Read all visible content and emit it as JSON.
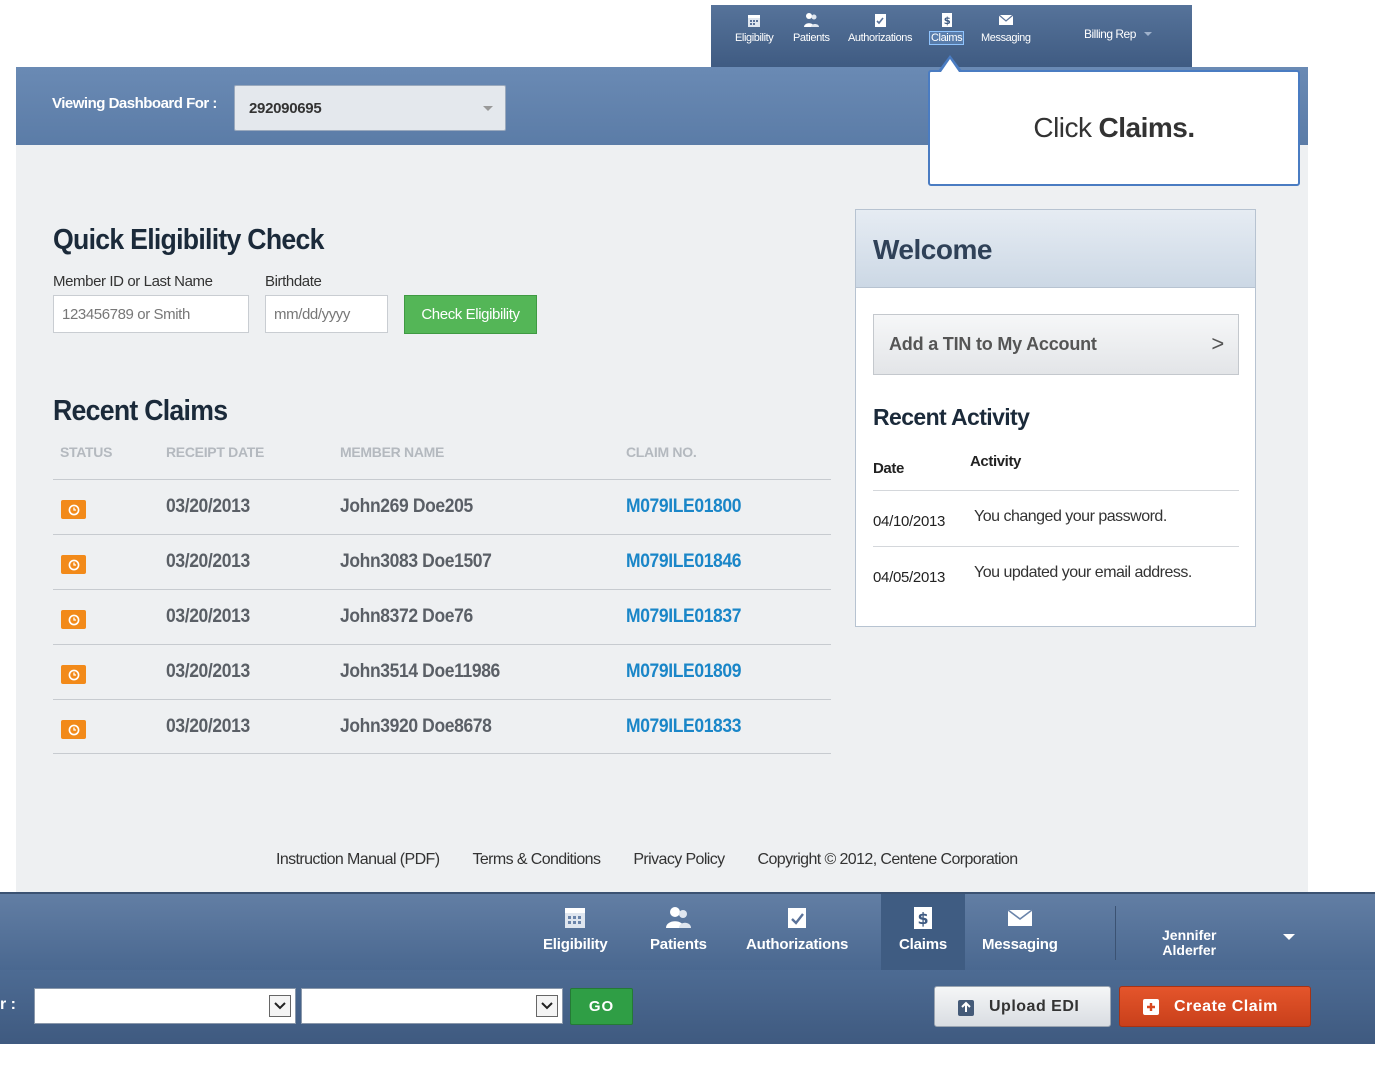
{
  "mini_nav": {
    "items": [
      {
        "label": "Eligibility",
        "icon": "calendar-icon"
      },
      {
        "label": "Patients",
        "icon": "people-icon"
      },
      {
        "label": "Authorizations",
        "icon": "checklist-icon"
      },
      {
        "label": "Claims",
        "icon": "dollar-doc-icon"
      },
      {
        "label": "Messaging",
        "icon": "envelope-icon"
      }
    ],
    "user": "Billing Rep"
  },
  "header": {
    "viewing_label": "Viewing Dashboard For :",
    "tin_value": "292090695"
  },
  "callout": {
    "prefix": "Click",
    "emphasis": "Claims."
  },
  "quick_eligibility": {
    "title": "Quick Eligibility Check",
    "member_label": "Member ID or Last Name",
    "member_placeholder": "123456789 or Smith",
    "birthdate_label": "Birthdate",
    "birthdate_placeholder": "mm/dd/yyyy",
    "button": "Check Eligibility"
  },
  "recent_claims": {
    "title": "Recent Claims",
    "columns": [
      "STATUS",
      "RECEIPT DATE",
      "MEMBER NAME",
      "CLAIM NO."
    ],
    "rows": [
      {
        "date": "03/20/2013",
        "member": "John269 Doe205",
        "claim": "M079ILE01800"
      },
      {
        "date": "03/20/2013",
        "member": "John3083 Doe1507",
        "claim": "M079ILE01846"
      },
      {
        "date": "03/20/2013",
        "member": "John8372 Doe76",
        "claim": "M079ILE01837"
      },
      {
        "date": "03/20/2013",
        "member": "John3514 Doe11986",
        "claim": "M079ILE01809"
      },
      {
        "date": "03/20/2013",
        "member": "John3920 Doe8678",
        "claim": "M079ILE01833"
      }
    ]
  },
  "welcome": {
    "title": "Welcome",
    "add_tin": "Add a TIN to My Account",
    "add_tin_chevron": ">",
    "recent_activity_title": "Recent Activity",
    "col_date": "Date",
    "col_activity": "Activity",
    "rows": [
      {
        "date": "04/10/2013",
        "text": "You changed your password."
      },
      {
        "date": "04/05/2013",
        "text": "You updated your email address."
      }
    ]
  },
  "footer": {
    "links": [
      "Instruction Manual (PDF)",
      "Terms & Conditions",
      "Privacy Policy"
    ],
    "copyright": "Copyright © 2012, Centene Corporation"
  },
  "bottom_nav": {
    "items": [
      {
        "label": "Eligibility"
      },
      {
        "label": "Patients"
      },
      {
        "label": "Authorizations"
      },
      {
        "label": "Claims"
      },
      {
        "label": "Messaging"
      }
    ],
    "user_first": "Jennifer",
    "user_last": "Alderfer"
  },
  "filter_bar": {
    "label": "r :",
    "go": "GO",
    "upload": "Upload EDI",
    "create": "Create Claim"
  },
  "colors": {
    "nav_blue": "#4a6890",
    "claim_link": "#1a86c8",
    "status_orange": "#f28a1a",
    "check_green": "#54b657",
    "create_red": "#d9481f"
  }
}
